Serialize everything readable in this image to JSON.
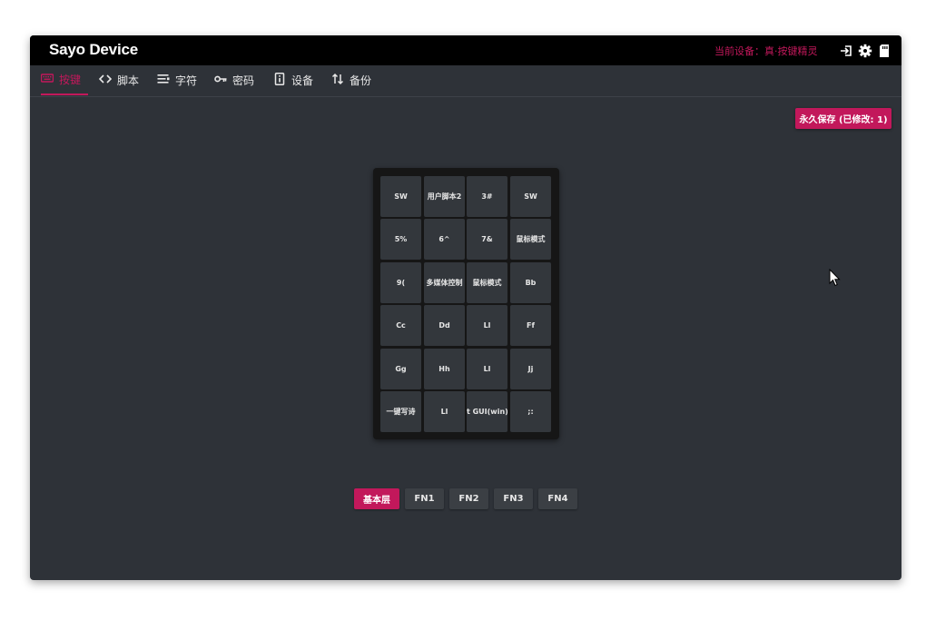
{
  "app": {
    "title": "Sayo Device",
    "current_device": "当前设备：真·按键精灵"
  },
  "topbar_icons": [
    "login-icon",
    "gear-icon",
    "sd-card-icon"
  ],
  "nav": {
    "tabs": [
      {
        "label": "按键",
        "icon": "keyboard-icon",
        "active": true
      },
      {
        "label": "脚本",
        "icon": "code-icon",
        "active": false
      },
      {
        "label": "字符",
        "icon": "text-lines-icon",
        "active": false
      },
      {
        "label": "密码",
        "icon": "key-icon",
        "active": false
      },
      {
        "label": "设备",
        "icon": "device-icon",
        "active": false
      },
      {
        "label": "备份",
        "icon": "swap-arrows-icon",
        "active": false
      }
    ]
  },
  "save_button": {
    "label": "永久保存 (已修改: 1)"
  },
  "keypad": {
    "rows": [
      [
        "SW",
        "用户脚本2",
        "3#",
        "SW"
      ],
      [
        "5%",
        "6^",
        "7&",
        "鼠标模式"
      ],
      [
        "9(",
        "多媒体控制",
        "鼠标模式",
        "Bb"
      ],
      [
        "Cc",
        "Dd",
        "Ll",
        "Ff"
      ],
      [
        "Gg",
        "Hh",
        "Ll",
        "Jj"
      ],
      [
        "一键写诗",
        "Ll",
        "t GUI(win) +",
        ";:"
      ]
    ]
  },
  "layers": [
    {
      "label": "基本层",
      "active": true
    },
    {
      "label": "FN1",
      "active": false
    },
    {
      "label": "FN2",
      "active": false
    },
    {
      "label": "FN3",
      "active": false
    },
    {
      "label": "FN4",
      "active": false
    }
  ],
  "colors": {
    "accent": "#c2185b",
    "background": "#2e3238",
    "topbar": "#000000",
    "key": "#33373c",
    "keypad": "#161616"
  }
}
